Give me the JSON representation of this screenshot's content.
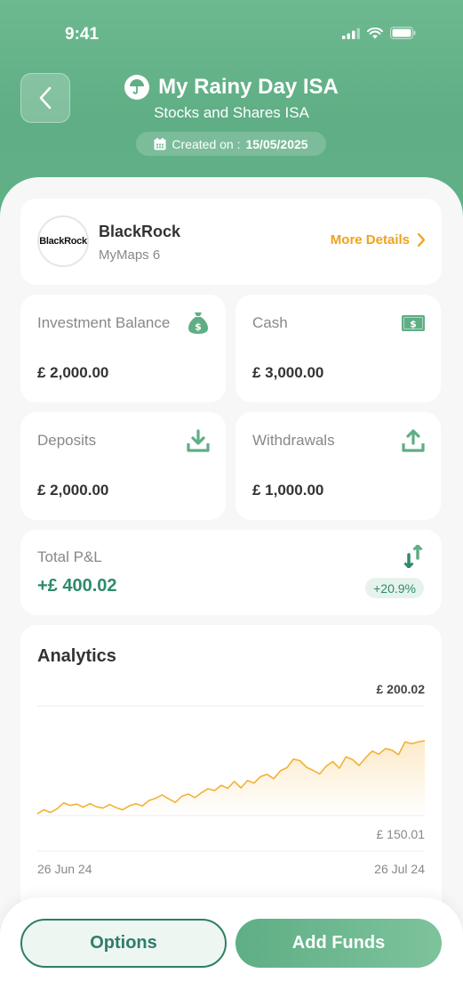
{
  "status_bar": {
    "time": "9:41"
  },
  "header": {
    "title": "My Rainy Day ISA",
    "subtitle": "Stocks and Shares ISA",
    "created_label": "Created on :",
    "created_date": "15/05/2025"
  },
  "provider": {
    "logo_text": "BlackRock",
    "name": "BlackRock",
    "product": "MyMaps 6",
    "more_details_label": "More Details"
  },
  "stats": {
    "investment_balance": {
      "label": "Investment Balance",
      "value": "£ 2,000.00",
      "icon": "money-bag-icon"
    },
    "cash": {
      "label": "Cash",
      "value": "£ 3,000.00",
      "icon": "banknote-icon"
    },
    "deposits": {
      "label": "Deposits",
      "value": "£ 2,000.00",
      "icon": "download-icon"
    },
    "withdrawals": {
      "label": "Withdrawals",
      "value": "£ 1,000.00",
      "icon": "upload-icon"
    }
  },
  "pl": {
    "label": "Total P&L",
    "value": "+£ 400.02",
    "percent": "+20.9%"
  },
  "analytics": {
    "title": "Analytics",
    "max_label": "£ 200.02",
    "min_label": "£ 150.01",
    "start_date": "26 Jun 24",
    "end_date": "26 Jul 24"
  },
  "actions": {
    "options_label": "Options",
    "add_funds_label": "Add Funds"
  },
  "colors": {
    "brand_green": "#5fae85",
    "accent_orange": "#f0a21b",
    "positive_green": "#2e8b6a",
    "chart_line": "#f2b233"
  },
  "chart_data": {
    "type": "line",
    "series": [
      {
        "values": [
          150.8,
          152.6,
          151.4,
          153.0,
          155.8,
          154.6,
          155.2,
          153.8,
          155.4,
          154.0,
          153.4,
          155.0,
          153.6,
          152.6,
          154.4,
          155.4,
          154.4,
          156.8,
          157.8,
          159.4,
          157.6,
          156.0,
          158.8,
          159.8,
          158.2,
          160.4,
          162.2,
          161.4,
          163.8,
          162.4,
          165.6,
          162.6,
          166.0,
          164.8,
          167.8,
          168.8,
          166.8,
          170.4,
          171.8,
          175.8,
          175.0,
          172.0,
          170.6,
          169.0,
          172.6,
          174.6,
          171.6,
          176.8,
          175.6,
          172.8,
          176.4,
          179.4,
          178.0,
          180.6,
          179.8,
          177.8,
          183.6,
          182.8,
          183.6,
          184.2
        ]
      }
    ],
    "ylim": [
      150.01,
      200.02
    ],
    "y_labels": [
      "£ 200.02",
      "£ 150.01"
    ],
    "x_labels": [
      "26 Jun 24",
      "26 Jul 24"
    ]
  }
}
